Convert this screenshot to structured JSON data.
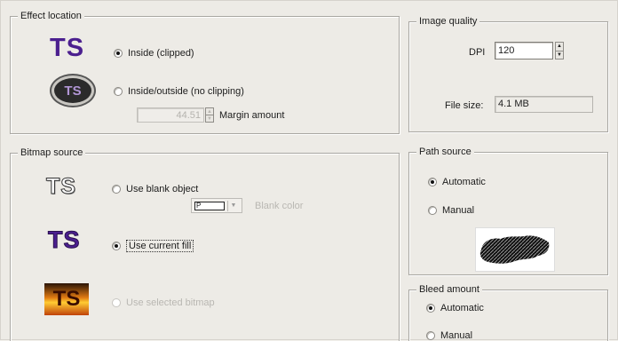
{
  "effect_location": {
    "title": "Effect location",
    "logo_text": "TS",
    "inside_label": "Inside (clipped)",
    "inside_outside_label": "Inside/outside (no clipping)",
    "margin_value": "44.51",
    "margin_label": "Margin amount",
    "selected": "inside"
  },
  "image_quality": {
    "title": "Image quality",
    "dpi_label": "DPI",
    "dpi_value": "120",
    "file_size_label": "File size:",
    "file_size_value": "4.1 MB"
  },
  "bitmap_source": {
    "title": "Bitmap source",
    "logo_text": "TS",
    "use_blank_label": "Use blank object",
    "blank_color_swatch_text": "P",
    "blank_color_label": "Blank color",
    "use_current_fill_label": "Use current fill",
    "use_selected_bitmap_label": "Use selected bitmap",
    "selected": "use_current_fill"
  },
  "path_source": {
    "title": "Path source",
    "automatic_label": "Automatic",
    "manual_label": "Manual",
    "selected": "automatic"
  },
  "bleed_amount": {
    "title": "Bleed amount",
    "automatic_label": "Automatic",
    "manual_label": "Manual",
    "selected": "automatic"
  },
  "colors": {
    "logo_purple": "#4b1f8f",
    "fire_orange": "#e07a12"
  }
}
